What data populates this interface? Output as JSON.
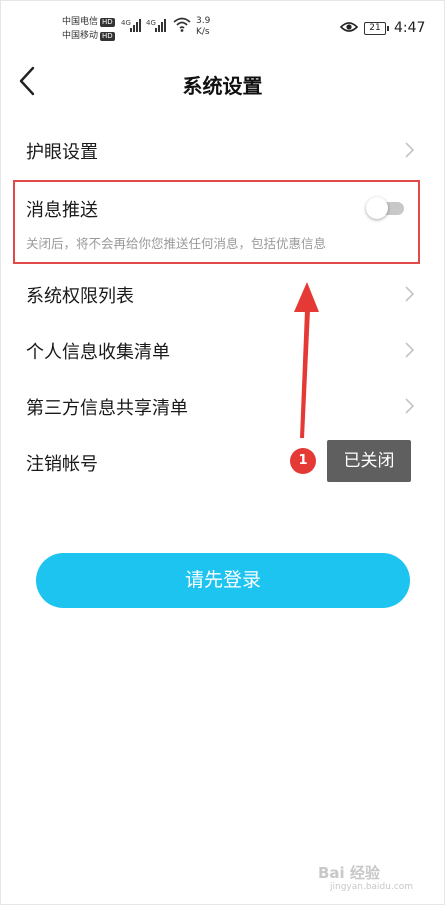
{
  "status_bar": {
    "carrier_1": "中国电信",
    "carrier_2": "中国移动",
    "hd": "HD",
    "signal_1": "4G",
    "signal_2": "4G",
    "speed_value": "3.9",
    "speed_unit": "K/s",
    "battery": "21",
    "time": "4:47"
  },
  "header": {
    "title": "系统设置"
  },
  "settings": {
    "items": [
      {
        "label": "护眼设置"
      },
      {
        "label": "消息推送",
        "description": "关闭后，将不会再给你您推送任何消息，包括优惠信息",
        "toggle_on": false
      },
      {
        "label": "系统权限列表"
      },
      {
        "label": "个人信息收集清单"
      },
      {
        "label": "第三方信息共享清单"
      },
      {
        "label": "注销帐号"
      }
    ]
  },
  "annotation": {
    "step": "1",
    "text": "已关闭",
    "color": "#e53935"
  },
  "login_button": {
    "label": "请先登录",
    "color": "#1ec4f0"
  },
  "watermark": {
    "brand": "Bai 经验",
    "url": "jingyan.baidu.com"
  },
  "icons": {
    "back": "arrow-left-icon",
    "chevron": "chevron-right-icon",
    "eye": "eye-icon",
    "wifi": "wifi-icon"
  }
}
